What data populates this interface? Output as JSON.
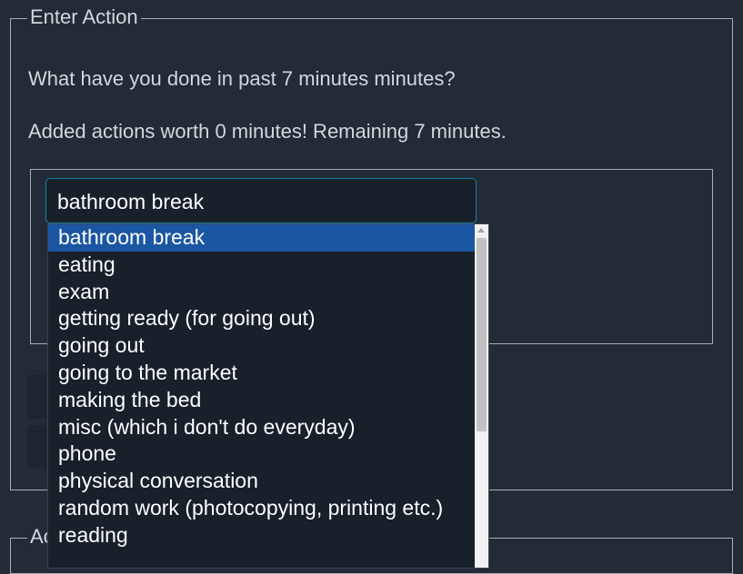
{
  "enter_action": {
    "legend": "Enter Action",
    "question": "What have you done in past 7 minutes minutes?",
    "status": "Added actions worth 0 minutes! Remaining 7 minutes.",
    "select": {
      "value": "bathroom break",
      "options": [
        "bathroom break",
        "eating",
        "exam",
        "getting ready (for going out)",
        "going out",
        "going to the market",
        "making the bed",
        "misc (which i don't do everyday)",
        "phone",
        "physical conversation",
        "random work (photocopying, printing etc.)",
        "reading"
      ],
      "selected_index": 0
    }
  },
  "second_section": {
    "legend": "Ac"
  },
  "colors": {
    "background": "#222b36",
    "selected_option": "#1b56a3",
    "input_border": "#1d7ea8",
    "text": "#d4d7db"
  }
}
